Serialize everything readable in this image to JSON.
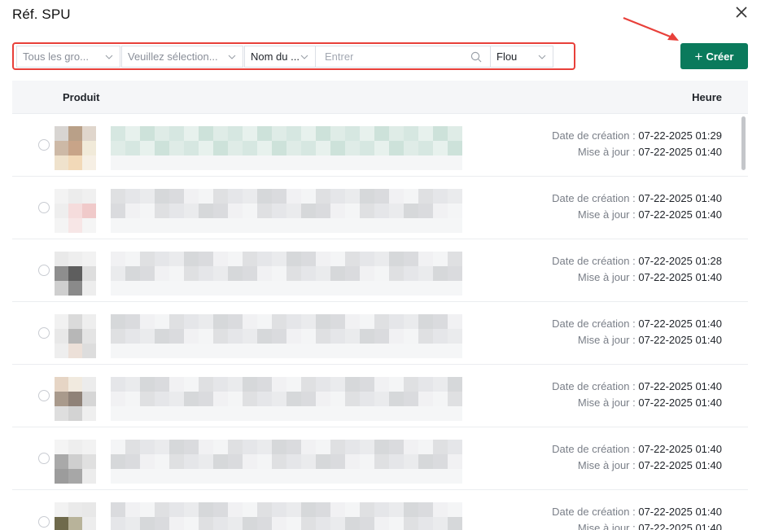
{
  "dialog": {
    "title": "Réf. SPU"
  },
  "filters": {
    "group": "Tous les gro...",
    "select": "Veuillez sélection...",
    "field": "Nom du ...",
    "search_placeholder": "Entrer",
    "mode": "Flou"
  },
  "create_button": {
    "label": "Créer"
  },
  "table": {
    "columns": {
      "product": "Produit",
      "time": "Heure"
    },
    "created_label": "Date de création : ",
    "updated_label": "Mise à jour : ",
    "rows": [
      {
        "created": "07-22-2025 01:29",
        "updated": "07-22-2025 01:40"
      },
      {
        "created": "07-22-2025 01:40",
        "updated": "07-22-2025 01:40"
      },
      {
        "created": "07-22-2025 01:28",
        "updated": "07-22-2025 01:40"
      },
      {
        "created": "07-22-2025 01:40",
        "updated": "07-22-2025 01:40"
      },
      {
        "created": "07-22-2025 01:40",
        "updated": "07-22-2025 01:40"
      },
      {
        "created": "07-22-2025 01:40",
        "updated": "07-22-2025 01:40"
      },
      {
        "created": "07-22-2025 01:40",
        "updated": "07-22-2025 01:40"
      }
    ]
  },
  "colors": {
    "accent": "#0a7a5c",
    "highlight": "#e8403a"
  },
  "icons": {
    "close": "close-icon",
    "search": "search-icon",
    "chevron": "chevron-down-icon",
    "plus": "plus-icon"
  }
}
